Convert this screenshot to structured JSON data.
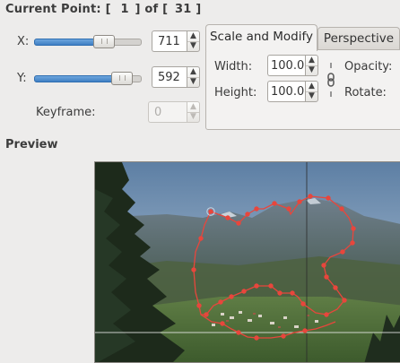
{
  "current_point": {
    "label": "Current Point:",
    "bracket_open_1": "[",
    "current": "1",
    "bracket_close_1": "]",
    "of_label": "of",
    "bracket_open_2": "[",
    "total": "31",
    "bracket_close_2": "]"
  },
  "x_control": {
    "label": "X:",
    "value": "711",
    "slider_level": 0.52
  },
  "y_control": {
    "label": "Y:",
    "value": "592",
    "slider_level": 0.76
  },
  "keyframe": {
    "label": "Keyframe:",
    "value": "0",
    "disabled": true
  },
  "tabs": [
    {
      "label": "Scale and Modify",
      "active": true
    },
    {
      "label": "Perspective",
      "active": false
    }
  ],
  "scale_modify": {
    "width_label": "Width:",
    "width_value": "100.0",
    "height_label": "Height:",
    "height_value": "100.0",
    "opacity_label": "Opacity:",
    "rotate_label": "Rotate:"
  },
  "preview": {
    "title": "Preview"
  },
  "spin_up_glyph": "▲",
  "spin_down_glyph": "▼",
  "colors": {
    "path_color": "#e8463c",
    "slider_fill": "#4a8bd0",
    "background": "#edeceb"
  }
}
